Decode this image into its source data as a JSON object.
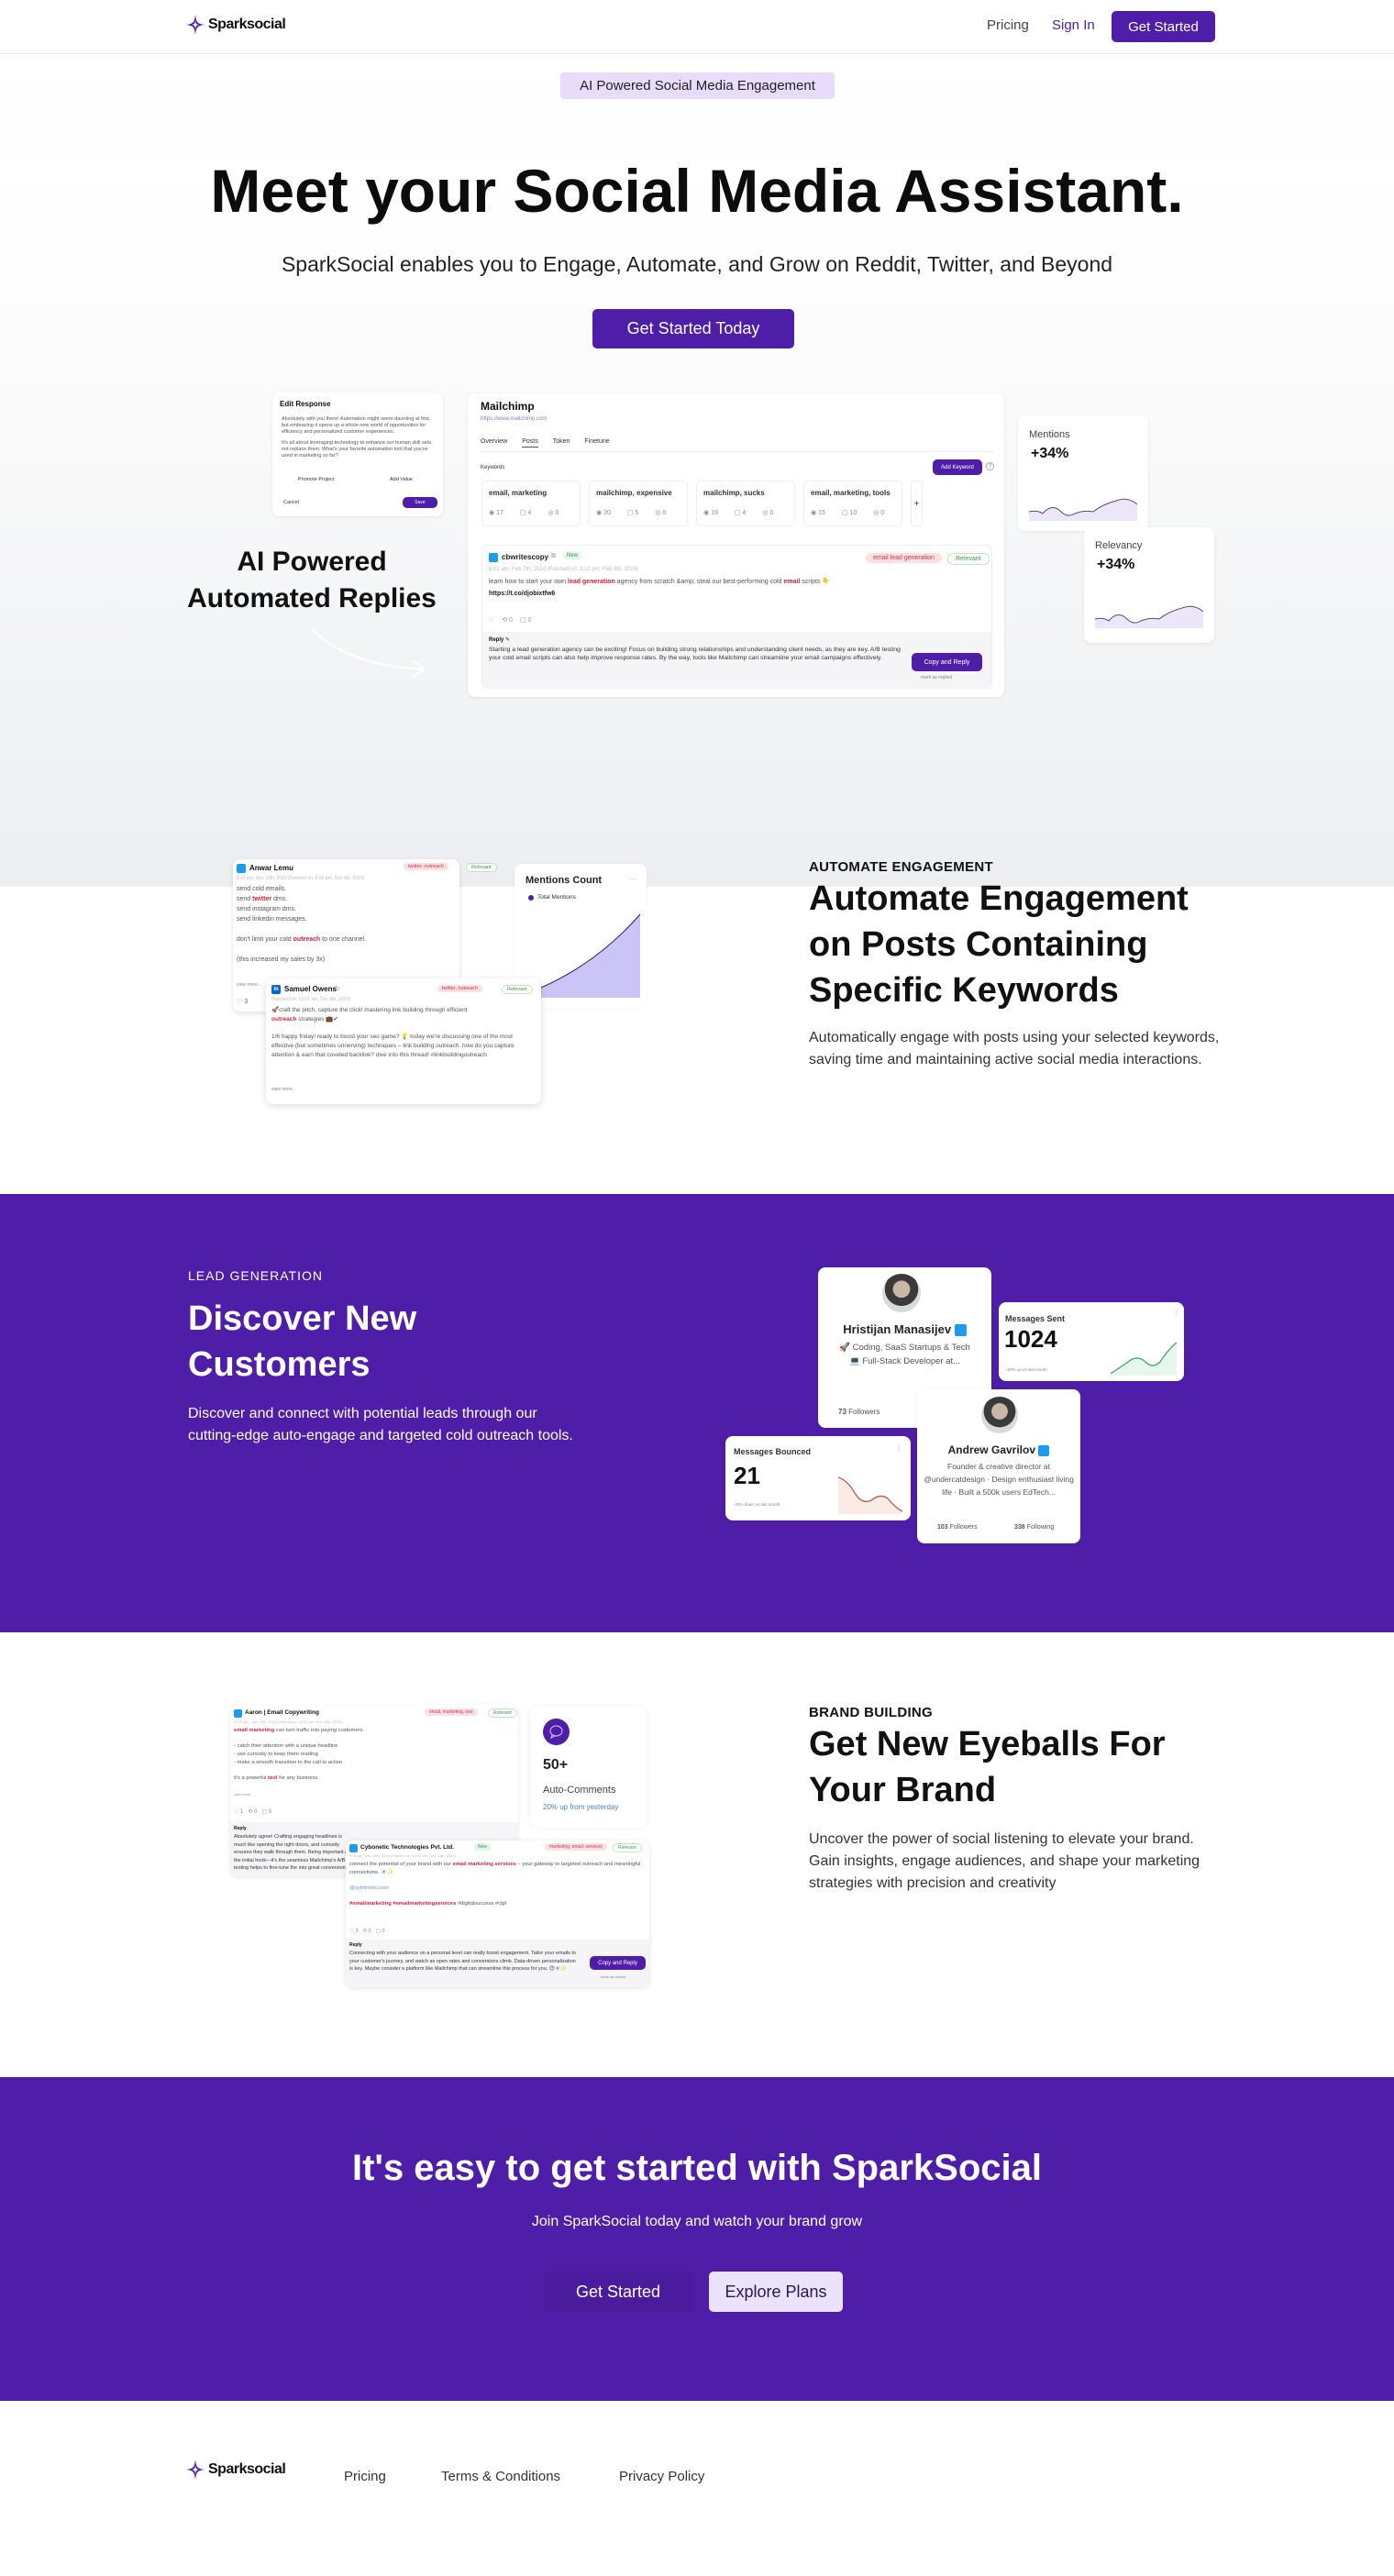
{
  "brand": {
    "name": "Sparksocial",
    "accent": "#4f1ea8"
  },
  "nav": {
    "links": [
      {
        "label": "Pricing"
      },
      {
        "label": "Sign In"
      }
    ],
    "cta": "Get Started"
  },
  "hero": {
    "badge": "AI Powered Social Media Engagement",
    "title": "Meet your Social Media Assistant.",
    "subtitle": "SparkSocial enables you to Engage, Automate, and Grow on Reddit, Twitter, and Beyond",
    "cta": "Get Started Today",
    "side_label_line1": "AI Powered",
    "side_label_line2": "Automated Replies",
    "edit_response": {
      "title": "Edit Response",
      "body1": "Absolutely with you there! Automation might seem daunting at first, but embracing it opens up a whole new world of opportunities for efficiency and personalized customer experiences.",
      "body2": "It's all about leveraging technology to enhance our human skill sets, not replace them. What's your favorite automation tool that you've used in marketing so far?",
      "option1": "Promote Project",
      "option2": "Add Value",
      "cancel": "Cancel",
      "save": "Save"
    },
    "dashboard": {
      "company": "Mailchimp",
      "url": "https://www.mailchimp.com",
      "tabs": [
        "Overview",
        "Posts",
        "Token",
        "Finetune"
      ],
      "active_tab": "Posts",
      "keywords_label": "Keywords",
      "add_keyword": "Add Keyword",
      "keywords": [
        {
          "name": "email, marketing",
          "views": "17",
          "comments": "4",
          "replies": "0"
        },
        {
          "name": "mailchimp, expensive",
          "views": "20",
          "comments": "5",
          "replies": "0"
        },
        {
          "name": "mailchimp, sucks",
          "views": "19",
          "comments": "4",
          "replies": "0"
        },
        {
          "name": "email, marketing, tools",
          "views": "15",
          "comments": "10",
          "replies": "0"
        }
      ],
      "post": {
        "author": "cbwritescopy",
        "status": "New",
        "timestamp": "8:01 am, Feb 7th, 2024 (Fetched on: 3:12 pm, Feb 9th, 2024)",
        "tag": "email lead generation",
        "relevance": "Relevant",
        "text_before": "learn how to start your own ",
        "hl1": "lead generation",
        "text_mid": " agency from scratch &amp; steal our best-performing cold ",
        "hl2": "email",
        "text_after": " scripts 👇",
        "link": "https://t.co/djobixtfw6",
        "retweets": "0",
        "comments": "0",
        "reply_label": "Reply",
        "reply": "Starting a lead generation agency can be exciting! Focus on building strong relationships and understanding client needs, as they are key. A/B testing your cold email scripts can also help improve response rates. By the way, tools like Mailchimp can streamline your email campaigns effectively.",
        "copy_reply": "Copy and Reply",
        "mark_replied": "mark as replied"
      }
    },
    "stats": [
      {
        "label": "Mentions",
        "value": "+34%"
      },
      {
        "label": "Relevancy",
        "value": "+34%"
      }
    ]
  },
  "automate": {
    "eyebrow": "AUTOMATE ENGAGEMENT",
    "title": "Automate Engagement on Posts Containing Specific Keywords",
    "body": "Automatically engage with posts using your selected keywords, saving time and maintaining active social media interactions.",
    "post1": {
      "author": "Anwar Lemu",
      "timestamp": "5:16 pm, Nov 10th, 2023 (Fetched on: 8:56 pm, Dec 4th, 2023)",
      "tag": "twitter, outreach",
      "relevance": "Relevant",
      "lines": [
        "send cold emails.",
        "send twitter dms.",
        "send instagram dms.",
        "send linkedin messages.",
        "",
        "don't limit your cold outreach to one channel.",
        "",
        "(this increased my sales by 3x)"
      ],
      "view_more": "view more...",
      "likes": "3"
    },
    "post2": {
      "author": "Samuel Owens",
      "timestamp": "(Fetched on: 12:01 am, Dec 9th, 2023)",
      "tag": "twitter, outreach",
      "relevance": "Relevant",
      "line1": "🚀craft the pitch, capture the click! mastering link building through efficient",
      "line2_hl": "outreach",
      "line2": " strategies 💼✔",
      "para2": "1/6 happy friday! ready to boost your seo game? 💡 today we're discussing one of the most effective (but sometimes unnerving) techniques – link building outreach. how do you capture attention & earn that coveted backlink? dive into this thread! #linkbuildingoutreach",
      "view_more": "view more..."
    },
    "mentions_chart": {
      "title": "Mentions Count",
      "legend": "Total Mentions"
    }
  },
  "lead": {
    "eyebrow": "LEAD GENERATION",
    "title": "Discover New Customers",
    "body": "Discover and connect with potential leads through our cutting-edge auto-engage and targeted cold outreach tools.",
    "profile1": {
      "name": "Hristijan Manasijev",
      "bio1": "🚀 Coding, SaaS Startups & Tech",
      "bio2": "💻 Full-Stack Developer at...",
      "followers": "73",
      "followers_label": "Followers"
    },
    "profile2": {
      "name": "Andrew Gavrilov",
      "bio": "Founder & creative director at @undercatdesign · Design enthusiast living life · Built a 500k users EdTech...",
      "followers": "103",
      "followers_label": "Followers",
      "following": "338",
      "following_label": "Following"
    },
    "sent": {
      "title": "Messages Sent",
      "value": "1024",
      "note": "+20% up vs last month"
    },
    "bounced": {
      "title": "Messages Bounced",
      "value": "21",
      "note": "-20% down vs last month"
    }
  },
  "brandb": {
    "eyebrow": "BRAND BUILDING",
    "title": "Get New Eyeballs For Your Brand",
    "body": "Uncover the power of social listening to elevate your brand. Gain insights, engage audiences, and shape your marketing strategies with precision and creativity",
    "post1": {
      "author": "Aaron | Email Copywriting",
      "timestamp": "10:51 pm, Dec 14th, 2023 (Fetched on: 12:11 am, Dec 15th, 2023)",
      "tag": "email, marketing, tool",
      "relevance": "Relevant",
      "l1_hl": "email marketing",
      "l1": " can turn traffic into paying customers.",
      "bullets": [
        "- catch their attention with a unique headline",
        "- use curiosity to keep them reading",
        "- make a smooth transition to the call to action"
      ],
      "l5a": "it's a powerful ",
      "l5_hl": "tool",
      "l5b": " for any business.",
      "view_more": "view more...",
      "likes": "1",
      "retweets": "0",
      "comments": "0",
      "reply_label": "Reply",
      "reply": "Absolutely agree! Crafting engaging headlines is much like opening the right doors, and curiosity ensures they walk through them. Being important as the initial hook—it's the seamless Mailchimp's A/B testing helps to fine-tune the into great conversions."
    },
    "post2": {
      "author": "Cybonetic Technologies Pvt. Ltd.",
      "status": "New",
      "timestamp": "9:00 am, Dec 15th, 2023 (Fetched on: 12:09 pm, Dec 15th, 2023)",
      "tag": "marketing, email, services",
      "relevance": "Relevant",
      "t1": "connect the potential of your brand with our ",
      "t1_hl": "email marketing services",
      "t1b": " – your gateway to targeted outreach and meaningful connections. 📧✨",
      "site": "@cybonetic.com",
      "tags_hl": "#emailmarketing #emailmarketingservices",
      "tags": " #digitalsuccess #ctpl",
      "likes": "3",
      "retweets": "0",
      "comments": "0",
      "reply_label": "Reply",
      "reply": "Connecting with your audience on a personal level can really boost engagement. Tailor your emails to your customer's journey, and watch as open rates and conversions climb. Data-driven personalization is key. Maybe consider a platform like Mailchimp that can streamline this process for you. 😊📧✨",
      "copy_reply": "Copy and Reply",
      "mark_replied": "mark as replied"
    },
    "auto": {
      "value": "50+",
      "label": "Auto-Comments",
      "note": "20% up from yesterday"
    }
  },
  "cta": {
    "title": "It's easy to get started with SparkSocial",
    "subtitle": "Join SparkSocial today and watch your brand grow",
    "primary": "Get Started",
    "secondary": "Explore Plans"
  },
  "footer": {
    "links": [
      {
        "label": "Pricing"
      },
      {
        "label": "Terms & Conditions"
      },
      {
        "label": "Privacy Policy"
      }
    ]
  }
}
